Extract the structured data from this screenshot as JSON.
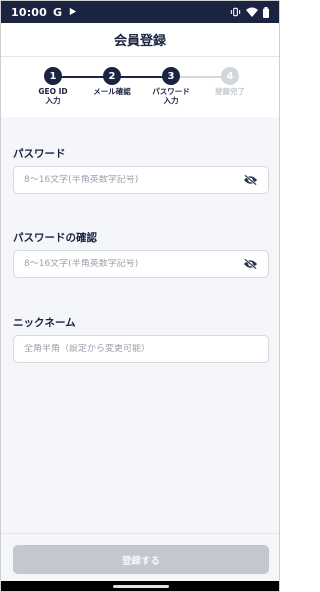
{
  "status_bar": {
    "time": "10:00",
    "google_badge": "G"
  },
  "header": {
    "title": "会員登録"
  },
  "stepper": {
    "steps": [
      {
        "number": "1",
        "label": "GEO ID\n入力",
        "active": true
      },
      {
        "number": "2",
        "label": "メール確認",
        "active": true
      },
      {
        "number": "3",
        "label": "パスワード\n入力",
        "active": true
      },
      {
        "number": "4",
        "label": "登録完了",
        "active": false
      }
    ]
  },
  "form": {
    "password": {
      "label": "パスワード",
      "placeholder": "8〜16文字(半角英数字記号)",
      "value": ""
    },
    "password_confirm": {
      "label": "パスワードの確認",
      "placeholder": "8〜16文字(半角英数字記号)",
      "value": ""
    },
    "nickname": {
      "label": "ニックネーム",
      "placeholder": "全角半角（設定から変更可能）",
      "value": ""
    }
  },
  "actions": {
    "submit_label": "登録する"
  },
  "icons": {
    "visibility_toggle": "eye-off-icon"
  },
  "colors": {
    "primary": "#1a2340",
    "inactive_step": "#d3d6dc",
    "disabled_button": "#c3c7cf",
    "background": "#f4f6fa"
  }
}
